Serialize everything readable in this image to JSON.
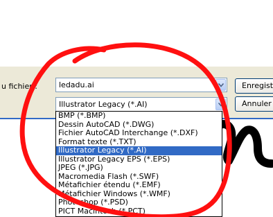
{
  "filename": {
    "label": "u fichier :",
    "value": "ledadu.ai"
  },
  "filetype": {
    "selected": "Illustrator Legacy (*.AI)",
    "options": [
      "BMP (*.BMP)",
      "Dessin AutoCAD (*.DWG)",
      "Fichier AutoCAD Interchange (*.DXF)",
      "Format texte (*.TXT)",
      "Illustrator Legacy (*.AI)",
      "Illustrator Legacy EPS (*.EPS)",
      "JPEG (*.JPG)",
      "Macromedia Flash (*.SWF)",
      "Métafichier étendu (*.EMF)",
      "Métafichier Windows (*.WMF)",
      "Photoshop (*.PSD)",
      "PICT Macintosh (*.PCT)"
    ],
    "highlighted_index": 4
  },
  "buttons": {
    "save_label": "Enregistrer",
    "cancel_label": "Annuler"
  },
  "colors": {
    "selection": "#316ac5",
    "annotation": "#ff1010",
    "dialog_bg": "#ece9d8"
  }
}
